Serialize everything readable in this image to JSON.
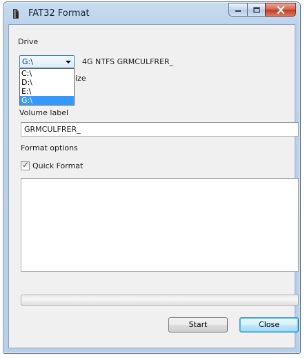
{
  "window": {
    "title": "FAT32 Format",
    "caption_buttons": [
      "minimize",
      "maximize",
      "close"
    ]
  },
  "drive": {
    "label": "Drive",
    "selected": "G:\\",
    "info": "4G NTFS GRMCULFRER_",
    "options": [
      "C:\\",
      "D:\\",
      "E:\\",
      "G:\\"
    ],
    "highlighted_index": 3
  },
  "allocation": {
    "label_visible_part": "ize"
  },
  "volume": {
    "label": "Volume label",
    "value": "GRMCULFRER_"
  },
  "format_options": {
    "label": "Format options",
    "quick_format_label": "Quick Format",
    "quick_format_checked": true
  },
  "progress": {
    "value_percent": 0
  },
  "buttons": {
    "start": "Start",
    "close": "Close"
  }
}
